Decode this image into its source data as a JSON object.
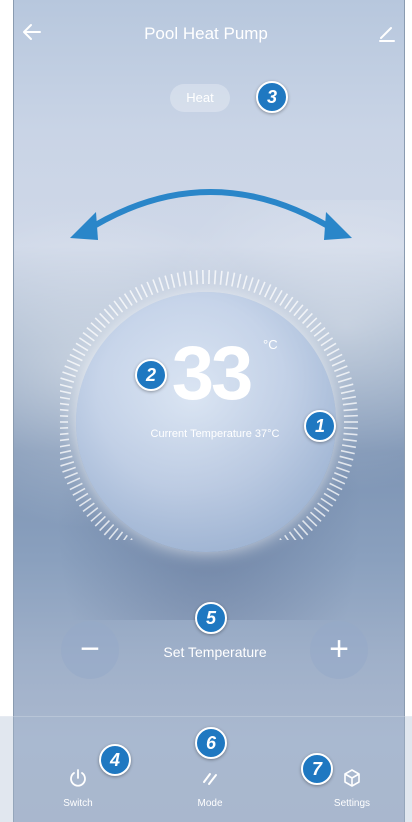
{
  "header": {
    "title": "Pool Heat Pump",
    "back_icon": "arrow-left-icon",
    "edit_icon": "pencil-icon"
  },
  "mode_pill": {
    "label": "Heat"
  },
  "dial": {
    "value": "33",
    "unit": "°C",
    "current_temperature_label": "Current Temperature 37°C",
    "swipe_hint_icon": "double-arrow-arc-icon"
  },
  "set_temperature": {
    "label": "Set Temperature",
    "decrease": "−",
    "increase": "+"
  },
  "bottom_nav": {
    "items": [
      {
        "label": "Switch",
        "icon": "power-icon"
      },
      {
        "label": "Mode",
        "icon": "mode-icon"
      },
      {
        "label": "Settings",
        "icon": "cube-settings-icon"
      }
    ]
  },
  "callouts": [
    "1",
    "2",
    "3",
    "4",
    "5",
    "6",
    "7"
  ],
  "colors": {
    "callout": "#1f78c1",
    "arc_arrow": "#2a86c9",
    "text": "#ffffff"
  }
}
